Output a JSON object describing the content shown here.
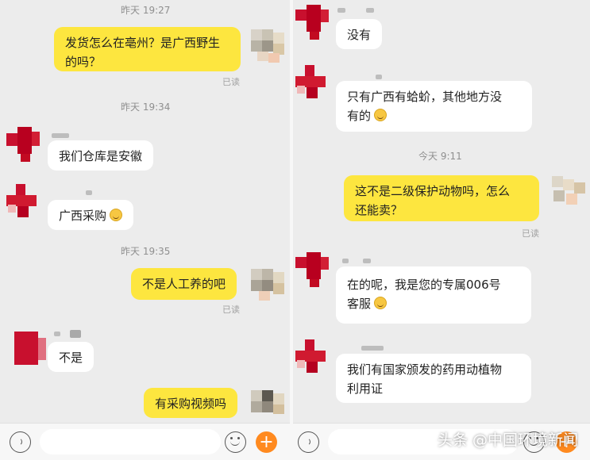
{
  "left": {
    "times": [
      "昨天 19:27",
      "昨天 19:34",
      "昨天 19:35"
    ],
    "messages": [
      {
        "text": "发货怎么在亳州？是广西野生的吗？",
        "line1": "发货怎么在亳州？是广西野生",
        "line2": "的吗？",
        "status": "已读"
      },
      {
        "text": "我们仓库是安徽"
      },
      {
        "text": "广西采购"
      },
      {
        "text": "不是人工养的吧",
        "status": "已读"
      },
      {
        "text": "不是"
      },
      {
        "text": "有采购视频吗"
      }
    ]
  },
  "right": {
    "times": [
      "今天 9:11"
    ],
    "messages": [
      {
        "text": "没有"
      },
      {
        "text": "只有广西有蛤蚧，其他地方没有的",
        "line1": "只有广西有蛤蚧，其他地方没",
        "line2": "有的"
      },
      {
        "text": "这不是二级保护动物吗，怎么还能卖？",
        "line1": "这不是二级保护动物吗，怎么",
        "line2": "还能卖？",
        "status": "已读"
      },
      {
        "text": "在的呢，我是您的专属006号客服",
        "line1": "在的呢，我是您的专属006号",
        "line2": "客服"
      },
      {
        "text": "我们有国家颁发的药用动植物利用证",
        "line1": "我们有国家颁发的药用动植物",
        "line2": "利用证"
      }
    ]
  },
  "icons": {
    "voice": "voice-icon",
    "emoji": "emoji-icon",
    "plus": "plus-icon",
    "smiley": "smiling-face-emoji"
  },
  "colors": {
    "bubble_sent": "#fde63f",
    "bubble_received": "#ffffff",
    "background": "#ececec",
    "plus_button": "#ff8a1f"
  },
  "watermark": "头条 @中国环境新闻"
}
